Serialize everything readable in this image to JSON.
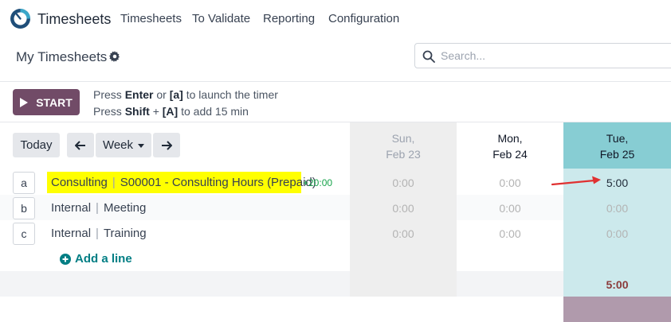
{
  "nav": {
    "app_name": "Timesheets",
    "menu": [
      "Timesheets",
      "To Validate",
      "Reporting",
      "Configuration"
    ]
  },
  "control": {
    "title": "My Timesheets",
    "search_placeholder": "Search..."
  },
  "timer": {
    "start_label": "START",
    "hint1": {
      "pre": "Press",
      "key1": "Enter",
      "mid": "or",
      "key2": "[a]",
      "post": "to launch the timer"
    },
    "hint2": {
      "pre": "Press",
      "key1": "Shift",
      "mid": "+",
      "key2": "[A]",
      "post": "to add 15 min"
    }
  },
  "grid": {
    "today_label": "Today",
    "scale_label": "Week",
    "days": [
      {
        "name": "Sun,",
        "date": "Feb 23"
      },
      {
        "name": "Mon,",
        "date": "Feb 24"
      },
      {
        "name": "Tue,",
        "date": "Feb 25"
      }
    ],
    "rows": [
      {
        "key": "a",
        "project": "Consulting",
        "task": "S00001 - Consulting Hours (Prepaid)",
        "delta": "+20:00",
        "values": [
          "0:00",
          "0:00",
          "5:00"
        ]
      },
      {
        "key": "b",
        "project": "Internal",
        "task": "Meeting",
        "values": [
          "0:00",
          "0:00",
          "0:00"
        ]
      },
      {
        "key": "c",
        "project": "Internal",
        "task": "Training",
        "values": [
          "0:00",
          "0:00",
          "0:00"
        ]
      }
    ],
    "add_line_label": "Add a line",
    "total_tue": "5:00"
  },
  "colors": {
    "brand": "#714b67",
    "today_column": "#87cdd3",
    "highlight": "#ffff00",
    "annotation_arrow": "#e03131"
  }
}
